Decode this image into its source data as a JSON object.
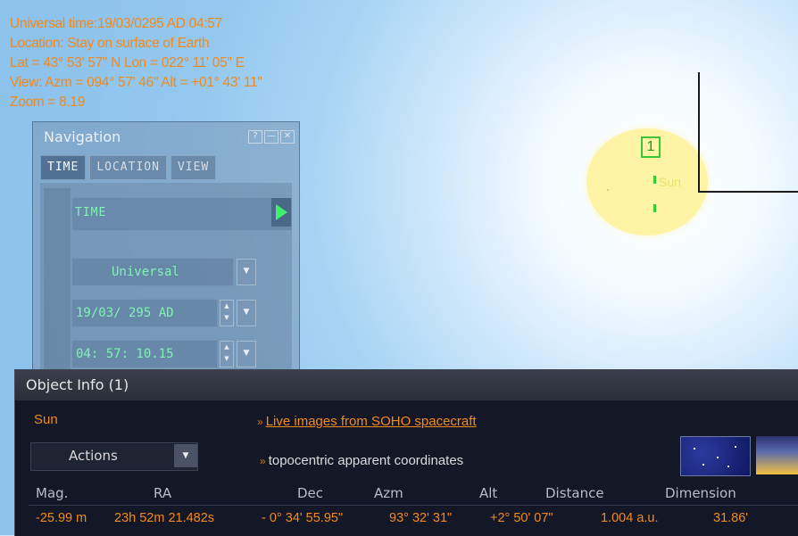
{
  "hud": {
    "line1": "Universal time:19/03/0295 AD 04:57",
    "line2": "Location: Stay on surface of Earth",
    "line3": "Lat = 43° 53' 57\" N  Lon = 022° 11' 05\" E",
    "line4": "View: Azm = 094° 57' 46\"  Alt = +01° 43' 11\"",
    "line5": "Zoom = 8.19"
  },
  "sky": {
    "marker_number": "1",
    "object_label": "Sun"
  },
  "navigation": {
    "title": "Navigation",
    "tabs": [
      "TIME",
      "LOCATION",
      "VIEW"
    ],
    "section_label": "TIME",
    "timezone": "Universal",
    "date": "19/03/ 295  AD",
    "time": "04: 57: 10.15"
  },
  "object_info": {
    "title": "Object Info (1)",
    "name": "Sun",
    "live_link": "Live images from SOHO spacecraft",
    "actions_label": "Actions",
    "coords_label": "topocentric apparent coordinates",
    "columns": [
      "Mag.",
      "RA",
      "Dec",
      "Azm",
      "Alt",
      "Distance",
      "Dimension"
    ],
    "values": [
      "-25.99 m",
      "23h 52m 21.482s",
      "- 0° 34' 55.95\"",
      "93° 32' 31\"",
      "+2° 50' 07\"",
      "1.004 a.u.",
      "31.86'"
    ]
  },
  "colors": {
    "hud_text": "#f08a1e",
    "nav_text": "#7ff2b4",
    "marker": "#3bc63b",
    "panel_bg": "#141826"
  }
}
